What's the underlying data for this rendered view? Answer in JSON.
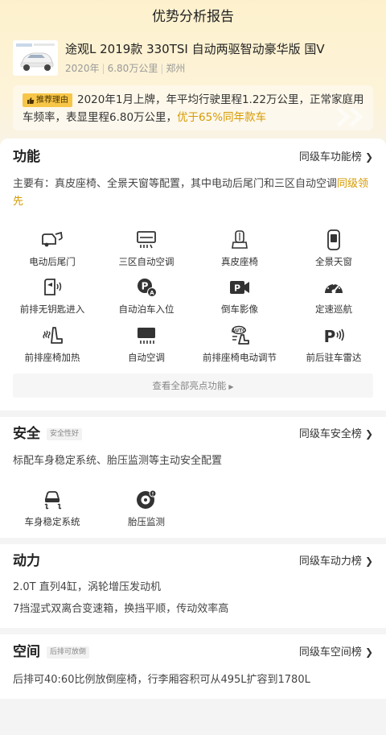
{
  "header": {
    "title": "优势分析报告"
  },
  "car": {
    "name": "途观L 2019款 330TSI 自动两驱智动豪华版 国V",
    "year": "2020年",
    "mileage": "6.80万公里",
    "city": "郑州"
  },
  "reason": {
    "badge": "推荐理由",
    "text": "2020年1月上牌，年平均行驶里程1.22万公里，正常家庭用车频率，表显里程6.80万公里，",
    "highlight": "优于65%同年款车"
  },
  "function_section": {
    "title": "功能",
    "rank_link": "同级车功能榜",
    "desc": "主要有：真皮座椅、全景天窗等配置，其中电动后尾门和三区自动空调",
    "desc_highlight": "同级领先",
    "features": [
      {
        "label": "电动后尾门",
        "icon": "power-tailgate-icon"
      },
      {
        "label": "三区自动空调",
        "icon": "climate-control-icon"
      },
      {
        "label": "真皮座椅",
        "icon": "leather-seat-icon"
      },
      {
        "label": "全景天窗",
        "icon": "sunroof-icon"
      },
      {
        "label": "前排无钥匙进入",
        "icon": "keyless-entry-icon"
      },
      {
        "label": "自动泊车入位",
        "icon": "auto-parking-icon"
      },
      {
        "label": "倒车影像",
        "icon": "reverse-camera-icon"
      },
      {
        "label": "定速巡航",
        "icon": "cruise-control-icon"
      },
      {
        "label": "前排座椅加热",
        "icon": "seat-heating-icon"
      },
      {
        "label": "自动空调",
        "icon": "auto-ac-icon"
      },
      {
        "label": "前排座椅电动调节",
        "icon": "power-seat-icon"
      },
      {
        "label": "前后驻车雷达",
        "icon": "parking-radar-icon"
      }
    ],
    "more_label": "查看全部亮点功能"
  },
  "safety_section": {
    "title": "安全",
    "tag": "安全性好",
    "rank_link": "同级车安全榜",
    "desc": "标配车身稳定系统、胎压监测等主动安全配置",
    "features": [
      {
        "label": "车身稳定系统",
        "icon": "stability-control-icon"
      },
      {
        "label": "胎压监测",
        "icon": "tire-pressure-icon"
      }
    ]
  },
  "power_section": {
    "title": "动力",
    "rank_link": "同级车动力榜",
    "lines": [
      "2.0T 直列4缸，涡轮增压发动机",
      "7挡湿式双离合变速箱，换挡平顺，传动效率高"
    ]
  },
  "space_section": {
    "title": "空间",
    "tag": "后排可放倒",
    "rank_link": "同级车空间榜",
    "desc": "后排可40:60比例放倒座椅，行李厢容积可从495L扩容到1780L"
  },
  "colors": {
    "accent": "#d69a00",
    "badge_bg": "#f7c648",
    "hero_bg": "#fdf1cd",
    "icon": "#333333"
  }
}
